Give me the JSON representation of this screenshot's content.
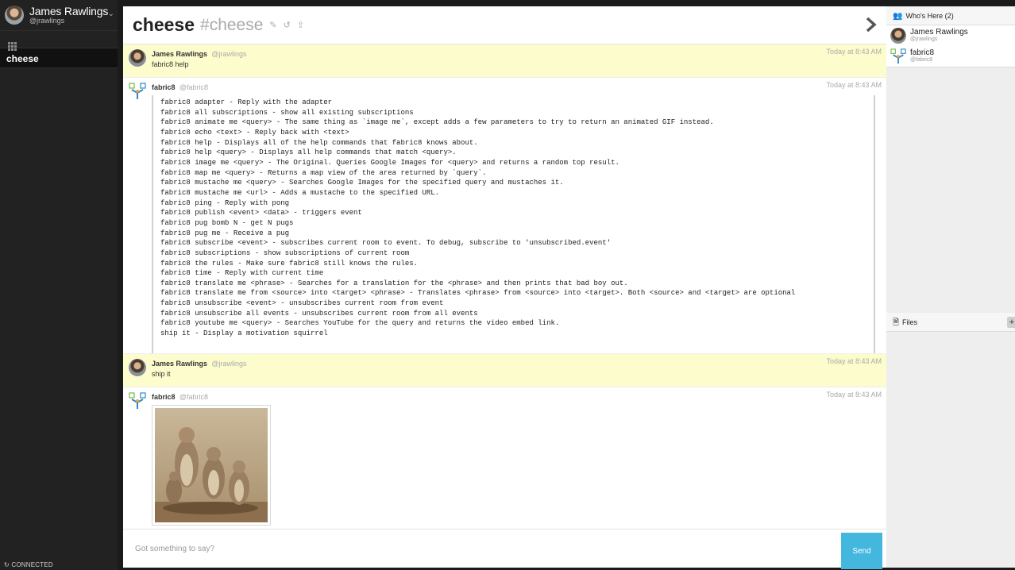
{
  "user": {
    "display_name": "James Rawlings",
    "handle": "@jrawlings"
  },
  "sidebar": {
    "rooms": [
      {
        "label": "cheese"
      }
    ],
    "status": "CONNECTED"
  },
  "room": {
    "name": "cheese",
    "tag": "#cheese"
  },
  "messages": [
    {
      "user": "James Rawlings",
      "handle": "@jrawlings",
      "time": "Today at 8:43 AM",
      "text": "fabric8 help"
    },
    {
      "user": "fabric8",
      "handle": "@fabric8",
      "time": "Today at 8:43 AM",
      "code": "fabric8 adapter - Reply with the adapter\nfabric8 all subscriptions - show all existing subscriptions\nfabric8 animate me <query> - The same thing as `image me`, except adds a few parameters to try to return an animated GIF instead.\nfabric8 echo <text> - Reply back with <text>\nfabric8 help - Displays all of the help commands that fabric8 knows about.\nfabric8 help <query> - Displays all help commands that match <query>.\nfabric8 image me <query> - The Original. Queries Google Images for <query> and returns a random top result.\nfabric8 map me <query> - Returns a map view of the area returned by `query`.\nfabric8 mustache me <query> - Searches Google Images for the specified query and mustaches it.\nfabric8 mustache me <url> - Adds a mustache to the specified URL.\nfabric8 ping - Reply with pong\nfabric8 publish <event> <data> - triggers event\nfabric8 pug bomb N - get N pugs\nfabric8 pug me - Receive a pug\nfabric8 subscribe <event> - subscribes current room to event. To debug, subscribe to 'unsubscribed.event'\nfabric8 subscriptions - show subscriptions of current room\nfabric8 the rules - Make sure fabric8 still knows the rules.\nfabric8 time - Reply with current time\nfabric8 translate me <phrase> - Searches for a translation for the <phrase> and then prints that bad boy out.\nfabric8 translate me from <source> into <target> <phrase> - Translates <phrase> from <source> into <target>. Both <source> and <target> are optional\nfabric8 unsubscribe <event> - unsubscribes current room from event\nfabric8 unsubscribe all events - unsubscribes current room from all events\nfabric8 youtube me <query> - Searches YouTube for the query and returns the video embed link.\nship it - Display a motivation squirrel"
    },
    {
      "user": "James Rawlings",
      "handle": "@jrawlings",
      "time": "Today at 8:43 AM",
      "text": "ship it"
    },
    {
      "user": "fabric8",
      "handle": "@fabric8",
      "time": "Today at 8:43 AM"
    }
  ],
  "composer": {
    "placeholder": "Got something to say?",
    "send_label": "Send"
  },
  "right_panel": {
    "who_title": "Who's Here (2)",
    "who": [
      {
        "name": "James Rawlings",
        "handle": "@jrawlings"
      },
      {
        "name": "fabric8",
        "handle": "@fabric8"
      }
    ],
    "files_title": "Files",
    "files_add": "+"
  }
}
